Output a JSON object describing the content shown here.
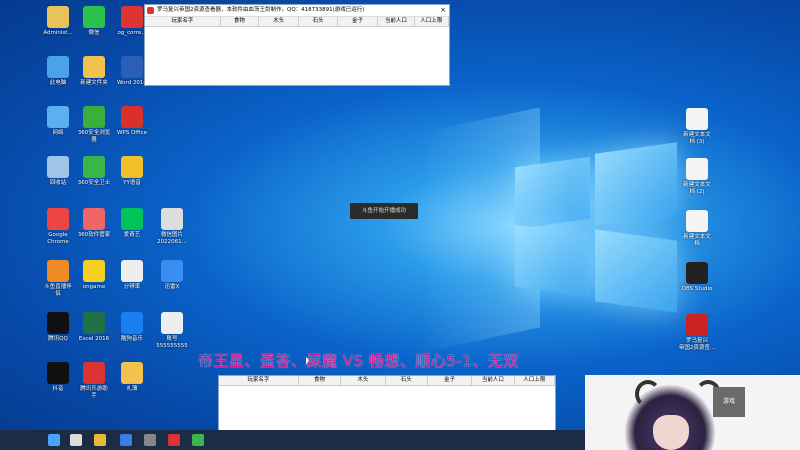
{
  "top_window": {
    "title": "罗马复兴帝国2资源查看器，本软件由血茨王剑制作。QQ：418733891(游戏已运行)",
    "close": "×",
    "columns": [
      "玩家名字",
      "食物",
      "木头",
      "石头",
      "金子",
      "当前人口",
      "人口上限"
    ]
  },
  "bottom_window": {
    "columns": [
      "玩家名字",
      "食物",
      "木头",
      "石头",
      "金子",
      "当前人口",
      "人口上限"
    ]
  },
  "toast": "斗鱼开始开播成功",
  "overlay_text": "帝王星、蛋答、屎魔  VS  畅想、顺心5-1、无双",
  "streamer_badge": "游戏",
  "desktop_icons_left": [
    {
      "label": "Administ...",
      "icon": "user-folder-icon",
      "color": "#e8c35a"
    },
    {
      "label": "微信",
      "icon": "wechat-icon",
      "color": "#2dc24f"
    },
    {
      "label": "og_corre...",
      "icon": "og-icon",
      "color": "#d33"
    },
    {
      "label": "此电脑",
      "icon": "computer-icon",
      "color": "#4aa3e8"
    },
    {
      "label": "新建文件夹",
      "icon": "folder-icon",
      "color": "#f2c14e"
    },
    {
      "label": "Word 2016",
      "icon": "word-icon",
      "color": "#2b5fb5"
    },
    {
      "label": "网络",
      "icon": "network-icon",
      "color": "#5ab0f0"
    },
    {
      "label": "360安全浏览\n器",
      "icon": "browser-360-icon",
      "color": "#3cae3a"
    },
    {
      "label": "WPS Office",
      "icon": "wps-icon",
      "color": "#d9302c"
    },
    {
      "label": "回收站",
      "icon": "recycle-bin-icon",
      "color": "#9fc6e8"
    },
    {
      "label": "360安全卫士",
      "icon": "guard-360-icon",
      "color": "#39b54a"
    },
    {
      "label": "YY语音",
      "icon": "yy-icon",
      "color": "#f0c12a"
    },
    {
      "label": "Google\nChrome",
      "icon": "chrome-icon",
      "color": "#e44"
    },
    {
      "label": "360软件管家",
      "icon": "softmgr-360-icon",
      "color": "#e66"
    },
    {
      "label": "爱奇艺",
      "icon": "iqiyi-icon",
      "color": "#00c35a"
    },
    {
      "label": "微信图片\n2022061...",
      "icon": "jpg-file-icon",
      "color": "#ddd"
    },
    {
      "label": "斗鱼直播伴\n侣",
      "icon": "douyu-icon",
      "color": "#f08a24"
    },
    {
      "label": "ongame",
      "icon": "ongame-icon",
      "color": "#f5d020"
    },
    {
      "label": "分辨率",
      "icon": "file-icon",
      "color": "#eee"
    },
    {
      "label": "迅雷X",
      "icon": "xunlei-icon",
      "color": "#3a8ef0"
    },
    {
      "label": "腾讯QQ",
      "icon": "qq-icon",
      "color": "#111"
    },
    {
      "label": "Excel 2016",
      "icon": "excel-icon",
      "color": "#207245"
    },
    {
      "label": "酷狗音乐",
      "icon": "kugou-icon",
      "color": "#1a7ef0"
    },
    {
      "label": "账号\n555555555",
      "icon": "text-file-icon",
      "color": "#eee"
    },
    {
      "label": "抖音",
      "icon": "douyin-icon",
      "color": "#111"
    },
    {
      "label": "腾讯乐游助\n手",
      "icon": "leyou-icon",
      "color": "#d33"
    },
    {
      "label": "礼薄",
      "icon": "folder-icon",
      "color": "#f2c14e"
    }
  ],
  "desktop_icons_right": [
    {
      "label": "新建文本文\n档 (3)",
      "icon": "text-doc-icon",
      "color": "#f4f4f4"
    },
    {
      "label": "新建文本文\n档 (2)",
      "icon": "text-doc-icon",
      "color": "#f4f4f4"
    },
    {
      "label": "新建文本文\n档",
      "icon": "text-doc-icon",
      "color": "#f4f4f4"
    },
    {
      "label": "OBS Studio",
      "icon": "obs-icon",
      "color": "#222"
    },
    {
      "label": "罗马复兴\n帝国2资源查...",
      "icon": "rome-app-icon",
      "color": "#c22"
    }
  ],
  "taskbar_icons": [
    {
      "icon": "windows-start-icon",
      "color": "#4aa3ff"
    },
    {
      "icon": "search-icon",
      "color": "#ddd"
    },
    {
      "icon": "app-yellow-icon",
      "color": "#e6b93a"
    },
    {
      "icon": "app-blue-icon",
      "color": "#3a7ee8"
    },
    {
      "icon": "app-dark-icon",
      "color": "#888"
    },
    {
      "icon": "app-red-icon",
      "color": "#d33"
    },
    {
      "icon": "app-green-icon",
      "color": "#3bb44a"
    }
  ]
}
